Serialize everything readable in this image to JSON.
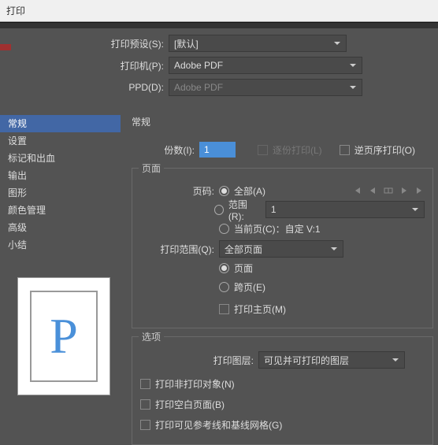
{
  "title": "打印",
  "topform": {
    "preset_label": "打印预设(S):",
    "preset_value": "[默认]",
    "printer_label": "打印机(P):",
    "printer_value": "Adobe PDF",
    "ppd_label": "PPD(D):",
    "ppd_value": "Adobe PDF"
  },
  "sidebar": {
    "items": [
      {
        "label": "常规"
      },
      {
        "label": "设置"
      },
      {
        "label": "标记和出血"
      },
      {
        "label": "输出"
      },
      {
        "label": "图形"
      },
      {
        "label": "颜色管理"
      },
      {
        "label": "高级"
      },
      {
        "label": "小结"
      }
    ]
  },
  "main": {
    "title": "常规",
    "copies_label": "份数(I):",
    "copies_value": "1",
    "collate_label": "逐份打印(L)",
    "reverse_label": "逆页序打印(O)",
    "pages": {
      "title": "页面",
      "page_label": "页码:",
      "all_label": "全部(A)",
      "range_label": "范围(R):",
      "range_value": "1",
      "current_label": "当前页(C)：自定 V:1",
      "scope_label": "打印范围(Q):",
      "scope_value": "全部页面",
      "page_opt": "页面",
      "spread_opt": "跨页(E)",
      "master_label": "打印主页(M)"
    },
    "options": {
      "title": "选项",
      "layer_label": "打印图层:",
      "layer_value": "可见并可打印的图层",
      "nonprint_label": "打印非打印对象(N)",
      "blank_label": "打印空白页面(B)",
      "guides_label": "打印可见参考线和基线网格(G)"
    }
  },
  "preview_letter": "P"
}
